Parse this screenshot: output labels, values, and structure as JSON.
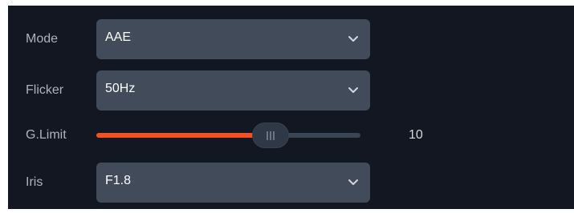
{
  "settings": {
    "mode": {
      "label": "Mode",
      "value": "AAE",
      "icon": "chevron-down-icon"
    },
    "flicker": {
      "label": "Flicker",
      "value": "50Hz",
      "icon": "chevron-down-icon"
    },
    "g_limit": {
      "label": "G.Limit",
      "value": "10",
      "fill_fraction": 0.66
    },
    "iris": {
      "label": "Iris",
      "value": "F1.8",
      "icon": "chevron-down-icon"
    }
  },
  "colors": {
    "panel_bg": "#121722",
    "select_bg": "#414b5a",
    "accent": "#f4511e",
    "track": "#3b4453"
  }
}
